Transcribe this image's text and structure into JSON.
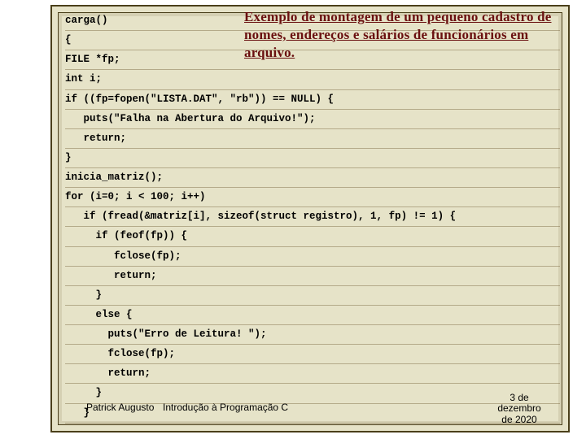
{
  "heading": "Exemplo de montagem de um pequeno cadastro de nomes, endereços e salários de funcionários em arquivo.",
  "code_lines": [
    "carga()",
    "{",
    "FILE *fp;",
    "int i;",
    "if ((fp=fopen(\"LISTA.DAT\", \"rb\")) == NULL) {",
    "   puts(\"Falha na Abertura do Arquivo!\");",
    "   return;",
    "}",
    "inicia_matriz();",
    "for (i=0; i < 100; i++)",
    "   if (fread(&matriz[i], sizeof(struct registro), 1, fp) != 1) {",
    "     if (feof(fp)) {",
    "        fclose(fp);",
    "        return;",
    "     }",
    "     else {",
    "       puts(\"Erro de Leitura! \");",
    "       fclose(fp);",
    "       return;",
    "     }",
    "   }"
  ],
  "footer": {
    "author": "Patrick Augusto",
    "title": "Introdução à Programação C",
    "date_line1": "3 de",
    "date_line2": "dezembro",
    "date_line3": "de 2020"
  }
}
